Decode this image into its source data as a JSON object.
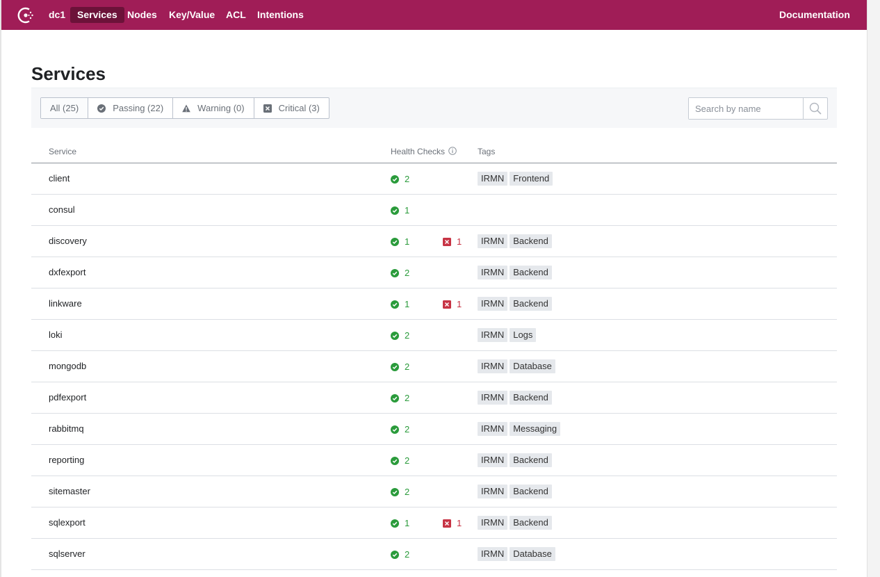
{
  "nav": {
    "datacenter": "dc1",
    "items": [
      {
        "label": "Services",
        "active": true
      },
      {
        "label": "Nodes",
        "active": false
      },
      {
        "label": "Key/Value",
        "active": false
      },
      {
        "label": "ACL",
        "active": false
      },
      {
        "label": "Intentions",
        "active": false
      }
    ],
    "documentation": "Documentation"
  },
  "page": {
    "title": "Services"
  },
  "filters": [
    {
      "label": "All (25)",
      "icon": "none",
      "selected": true
    },
    {
      "label": "Passing (22)",
      "icon": "passing-icon"
    },
    {
      "label": "Warning (0)",
      "icon": "warning-icon"
    },
    {
      "label": "Critical (3)",
      "icon": "critical-icon"
    }
  ],
  "search": {
    "placeholder": "Search by name"
  },
  "table": {
    "headers": {
      "service": "Service",
      "health": "Health Checks",
      "tags": "Tags"
    },
    "rows": [
      {
        "name": "client",
        "passing": "2",
        "critical": "",
        "tags": [
          "IRMN",
          "Frontend"
        ]
      },
      {
        "name": "consul",
        "passing": "1",
        "critical": "",
        "tags": []
      },
      {
        "name": "discovery",
        "passing": "1",
        "critical": "1",
        "tags": [
          "IRMN",
          "Backend"
        ]
      },
      {
        "name": "dxfexport",
        "passing": "2",
        "critical": "",
        "tags": [
          "IRMN",
          "Backend"
        ]
      },
      {
        "name": "linkware",
        "passing": "1",
        "critical": "1",
        "tags": [
          "IRMN",
          "Backend"
        ]
      },
      {
        "name": "loki",
        "passing": "2",
        "critical": "",
        "tags": [
          "IRMN",
          "Logs"
        ]
      },
      {
        "name": "mongodb",
        "passing": "2",
        "critical": "",
        "tags": [
          "IRMN",
          "Database"
        ]
      },
      {
        "name": "pdfexport",
        "passing": "2",
        "critical": "",
        "tags": [
          "IRMN",
          "Backend"
        ]
      },
      {
        "name": "rabbitmq",
        "passing": "2",
        "critical": "",
        "tags": [
          "IRMN",
          "Messaging"
        ]
      },
      {
        "name": "reporting",
        "passing": "2",
        "critical": "",
        "tags": [
          "IRMN",
          "Backend"
        ]
      },
      {
        "name": "sitemaster",
        "passing": "2",
        "critical": "",
        "tags": [
          "IRMN",
          "Backend"
        ]
      },
      {
        "name": "sqlexport",
        "passing": "1",
        "critical": "1",
        "tags": [
          "IRMN",
          "Backend"
        ]
      },
      {
        "name": "sqlserver",
        "passing": "2",
        "critical": "",
        "tags": [
          "IRMN",
          "Database"
        ]
      }
    ]
  },
  "colors": {
    "brand": "#a01d57",
    "brand_active": "#6c1239",
    "passing": "#2a9b3b",
    "critical": "#c73445",
    "warning": "#6a7078"
  }
}
